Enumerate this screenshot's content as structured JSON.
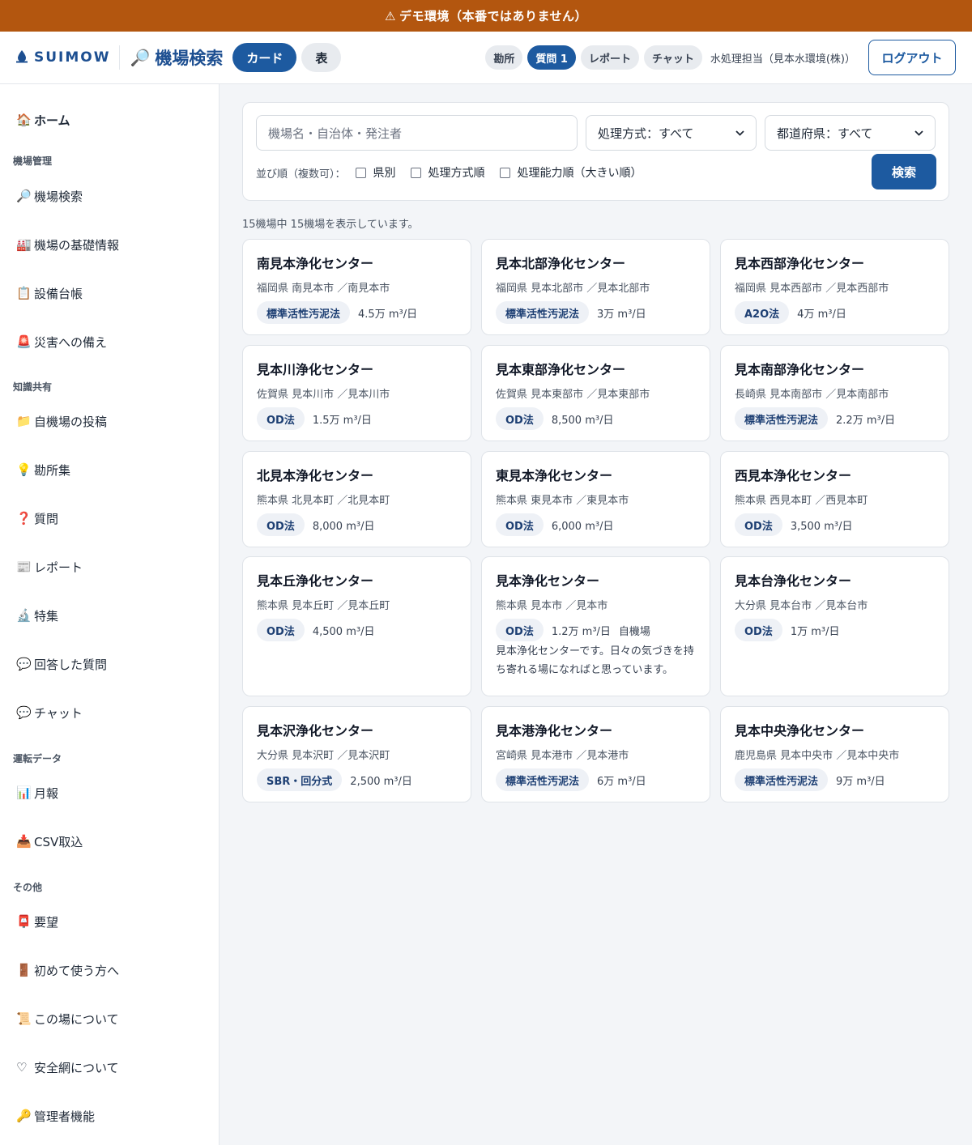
{
  "banner": {
    "icon": "warning-icon",
    "text": "デモ環境（本番ではありません）"
  },
  "header": {
    "logo_text": "SUIMOW",
    "page_title": "機場検索",
    "view_card": "カード",
    "view_table": "表",
    "pills": [
      "勘所",
      "質問 1",
      "レポート",
      "チャット"
    ],
    "user": "水処理担当（見本水環境(株)）",
    "logout": "ログアウト"
  },
  "sidebar": {
    "home": "ホーム",
    "sections": [
      "機場管理",
      "知識共有",
      "運転データ",
      "その他"
    ],
    "items": [
      {
        "icon": "🔎",
        "label": "機場検索"
      },
      {
        "icon": "🏭",
        "label": "機場の基礎情報"
      },
      {
        "icon": "📋",
        "label": "設備台帳"
      },
      {
        "icon": "🚨",
        "label": "災害への備え"
      },
      {
        "icon": "📁",
        "label": "自機場の投稿"
      },
      {
        "icon": "💡",
        "label": "勘所集"
      },
      {
        "icon": "❓",
        "label": "質問"
      },
      {
        "icon": "📰",
        "label": "レポート"
      },
      {
        "icon": "🔬",
        "label": "特集"
      },
      {
        "icon": "💬",
        "label": "回答した質問"
      },
      {
        "icon": "💬",
        "label": "チャット"
      },
      {
        "icon": "📊",
        "label": "月報"
      },
      {
        "icon": "📥",
        "label": "CSV取込"
      },
      {
        "icon": "📮",
        "label": "要望"
      },
      {
        "icon": "🚪",
        "label": "初めて使う方へ"
      },
      {
        "icon": "📜",
        "label": "この場について"
      },
      {
        "icon": "♡",
        "label": "安全網について"
      },
      {
        "icon": "🔑",
        "label": "管理者機能"
      }
    ]
  },
  "search": {
    "placeholder": "機場名・自治体・発注者",
    "method_select": "処理方式：すべて",
    "pref_select": "都道府県：すべて",
    "sort_label": "並び順（複数可）：",
    "sort_options": [
      "県別",
      "処理方式順",
      "処理能力順（大きい順）"
    ],
    "button": "検索"
  },
  "result_count": "15機場中 15機場を表示しています。",
  "cards": [
    {
      "name": "南見本浄化センター",
      "loc": "福岡県 南見本市 ／南見本市",
      "method": "標準活性汚泥法",
      "cap": "4.5万 m³/日",
      "own": "",
      "desc": ""
    },
    {
      "name": "見本北部浄化センター",
      "loc": "福岡県 見本北部市 ／見本北部市",
      "method": "標準活性汚泥法",
      "cap": "3万 m³/日",
      "own": "",
      "desc": ""
    },
    {
      "name": "見本西部浄化センター",
      "loc": "福岡県 見本西部市 ／見本西部市",
      "method": "A2O法",
      "cap": "4万 m³/日",
      "own": "",
      "desc": ""
    },
    {
      "name": "見本川浄化センター",
      "loc": "佐賀県 見本川市 ／見本川市",
      "method": "OD法",
      "cap": "1.5万 m³/日",
      "own": "",
      "desc": ""
    },
    {
      "name": "見本東部浄化センター",
      "loc": "佐賀県 見本東部市 ／見本東部市",
      "method": "OD法",
      "cap": "8,500 m³/日",
      "own": "",
      "desc": ""
    },
    {
      "name": "見本南部浄化センター",
      "loc": "長崎県 見本南部市 ／見本南部市",
      "method": "標準活性汚泥法",
      "cap": "2.2万 m³/日",
      "own": "",
      "desc": ""
    },
    {
      "name": "北見本浄化センター",
      "loc": "熊本県 北見本町 ／北見本町",
      "method": "OD法",
      "cap": "8,000 m³/日",
      "own": "",
      "desc": ""
    },
    {
      "name": "東見本浄化センター",
      "loc": "熊本県 東見本市 ／東見本市",
      "method": "OD法",
      "cap": "6,000 m³/日",
      "own": "",
      "desc": ""
    },
    {
      "name": "西見本浄化センター",
      "loc": "熊本県 西見本町 ／西見本町",
      "method": "OD法",
      "cap": "3,500 m³/日",
      "own": "",
      "desc": ""
    },
    {
      "name": "見本丘浄化センター",
      "loc": "熊本県 見本丘町 ／見本丘町",
      "method": "OD法",
      "cap": "4,500 m³/日",
      "own": "",
      "desc": ""
    },
    {
      "name": "見本浄化センター",
      "loc": "熊本県 見本市 ／見本市",
      "method": "OD法",
      "cap": "1.2万 m³/日",
      "own": "自機場",
      "desc": "見本浄化センターです。日々の気づきを持ち寄れる場になればと思っています。"
    },
    {
      "name": "見本台浄化センター",
      "loc": "大分県 見本台市 ／見本台市",
      "method": "OD法",
      "cap": "1万 m³/日",
      "own": "",
      "desc": ""
    },
    {
      "name": "見本沢浄化センター",
      "loc": "大分県 見本沢町 ／見本沢町",
      "method": "SBR・回分式",
      "cap": "2,500 m³/日",
      "own": "",
      "desc": ""
    },
    {
      "name": "見本港浄化センター",
      "loc": "宮崎県 見本港市 ／見本港市",
      "method": "標準活性汚泥法",
      "cap": "6万 m³/日",
      "own": "",
      "desc": ""
    },
    {
      "name": "見本中央浄化センター",
      "loc": "鹿児島県 見本中央市 ／見本中央市",
      "method": "標準活性汚泥法",
      "cap": "9万 m³/日",
      "own": "",
      "desc": ""
    }
  ]
}
